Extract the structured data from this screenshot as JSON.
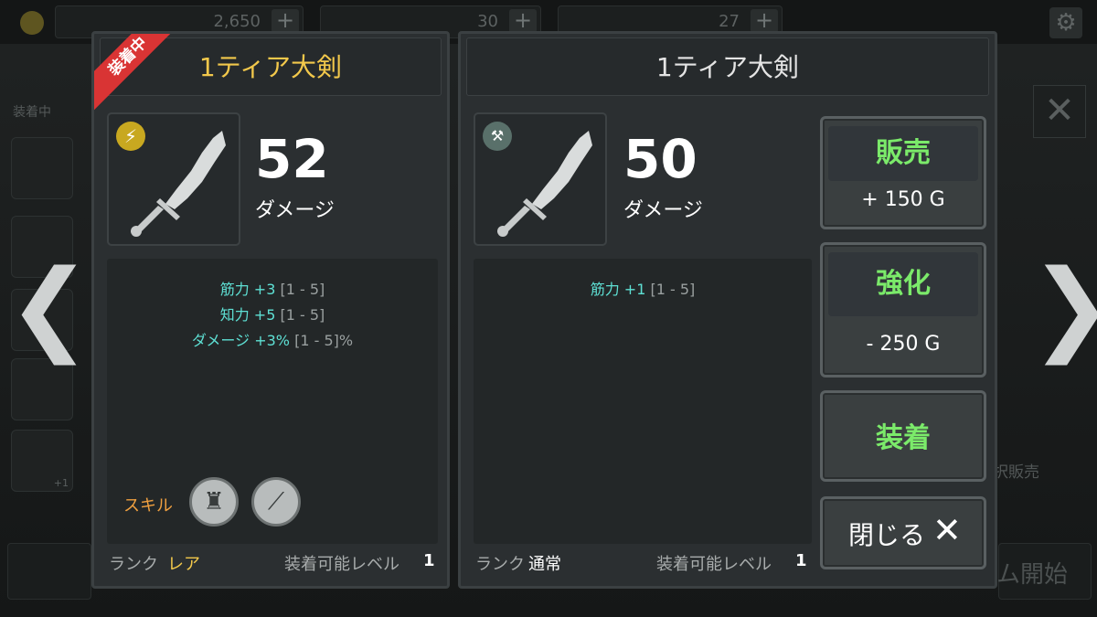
{
  "topbar": {
    "gold": "2,650",
    "gems": "30",
    "tickets": "27",
    "plus": "+"
  },
  "background": {
    "equipped_label": "装着中",
    "ring_badge": "+1",
    "sell_select_label": "択販売",
    "start_label": "ム開始"
  },
  "navigation": {
    "prev_arrow": "❮",
    "next_arrow": "❯"
  },
  "equipped_item": {
    "ribbon": "装着中",
    "title": "1ティア大剣",
    "badge_icon": "lightning-icon",
    "damage_value": "52",
    "damage_label": "ダメージ",
    "stats": [
      {
        "name": "筋力 +3",
        "range": "[1 - 5]"
      },
      {
        "name": "知力 +5",
        "range": "[1 - 5]"
      },
      {
        "name": "ダメージ +3%",
        "range": "[1 - 5]%"
      }
    ],
    "skill_label": "スキル",
    "rank_label": "ランク",
    "rank_value": "レア",
    "level_label": "装着可能レベル",
    "level_value": "1"
  },
  "selected_item": {
    "title": "1ティア大剣",
    "badge_icon": "anvil-icon",
    "damage_value": "50",
    "damage_label": "ダメージ",
    "stats": [
      {
        "name": "筋力 +1",
        "range": "[1 - 5]"
      }
    ],
    "rank_label": "ランク",
    "rank_value": "通常",
    "level_label": "装着可能レベル",
    "level_value": "1"
  },
  "actions": {
    "sell": {
      "label": "販売",
      "value": "+ 150 G"
    },
    "enhance": {
      "label": "強化",
      "value": "- 250 G"
    },
    "equip": {
      "label": "装着"
    },
    "close": {
      "label": "閉じる"
    }
  },
  "colors": {
    "accent_gold": "#f2c84b",
    "stat_cyan": "#5ee0d4",
    "action_green": "#7bea6a",
    "ribbon_red": "#d93434",
    "skill_orange": "#f0a040"
  }
}
